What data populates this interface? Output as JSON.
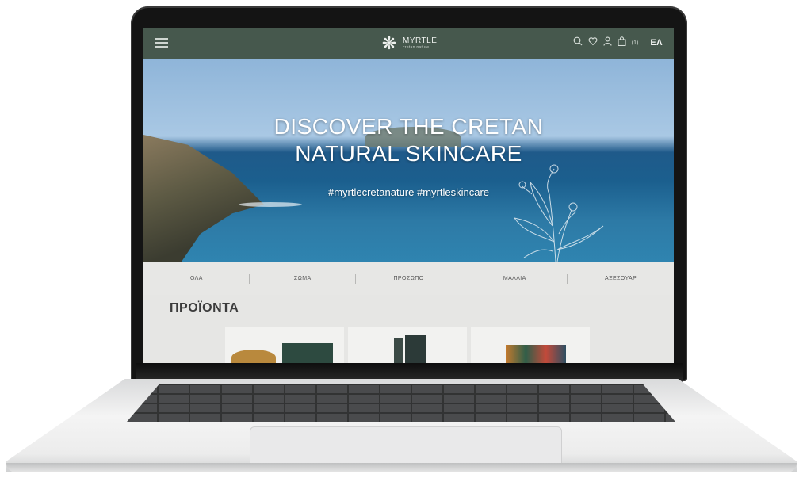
{
  "brand": {
    "name": "MYRTLE",
    "tagline": "cretan nature"
  },
  "nav": {
    "cart_count": "(1)",
    "language": "ΕΛ"
  },
  "hero": {
    "title_line1": "DISCOVER THE CRETAN",
    "title_line2": "NATURAL SKINCARE",
    "hashtags": "#myrtlecretanature  #myrtleskincare"
  },
  "categories": [
    "ΟΛΑ",
    "ΣΩΜΑ",
    "ΠΡΟΣΩΠΟ",
    "ΜΑΛΛΙΑ",
    "ΑΞΕΣΟΥΑΡ"
  ],
  "products_section": {
    "title": "ΠΡΟΪΟΝΤΑ"
  },
  "icons": {
    "menu": "hamburger-icon",
    "search": "search-icon",
    "wishlist": "heart-icon",
    "account": "user-icon",
    "cart": "bag-icon"
  },
  "colors": {
    "nav_bg": "#46584d",
    "page_bg": "#e6e6e4"
  }
}
